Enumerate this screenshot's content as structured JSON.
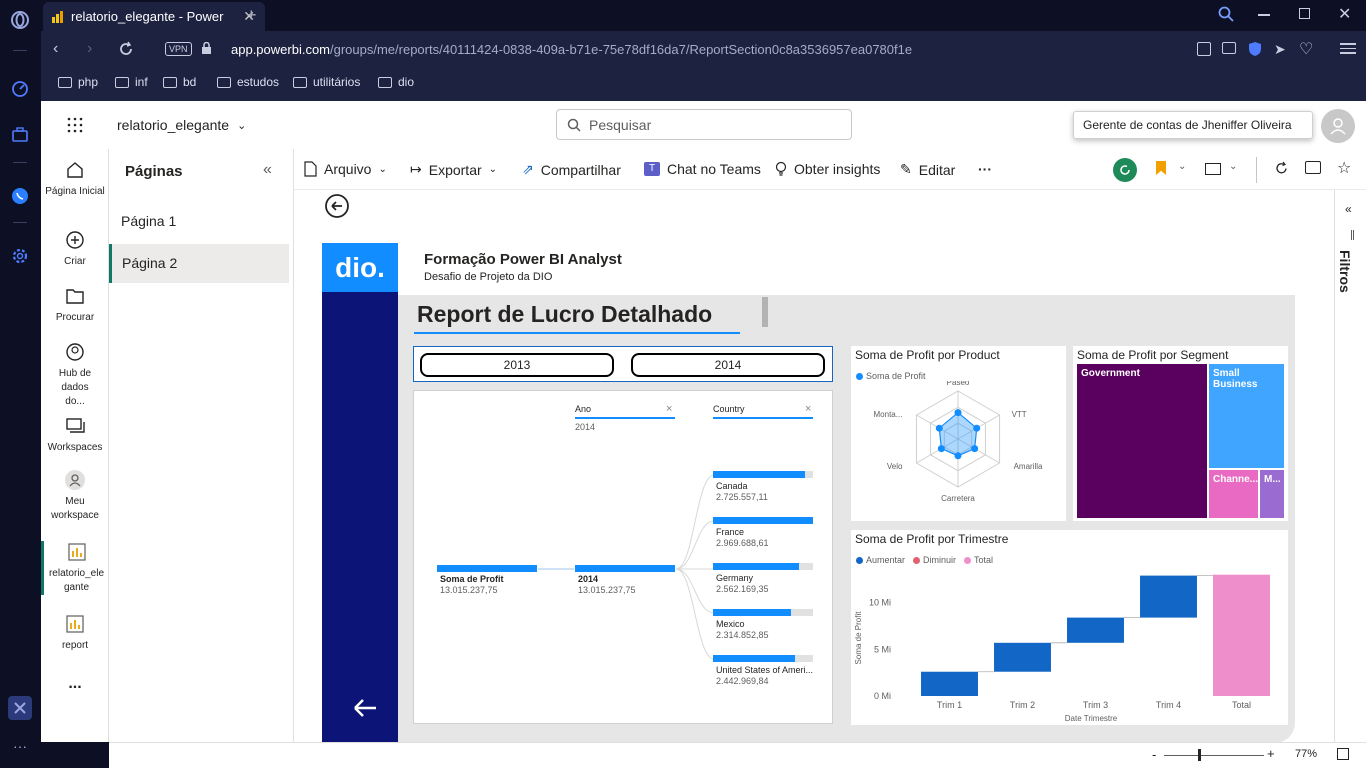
{
  "browser": {
    "tab_title": "relatorio_elegante - Power",
    "vpn_label": "VPN",
    "url_domain": "app.powerbi.com",
    "url_path": "/groups/me/reports/40111424-0838-409a-b71e-75e78df16da7/ReportSection0c8a3536957ea0780f1e",
    "bookmarks": [
      "php",
      "inf",
      "bd",
      "estudos",
      "utilitários",
      "dio"
    ]
  },
  "header": {
    "report_name": "relatorio_elegante",
    "search_placeholder": "Pesquisar",
    "account_tooltip": "Gerente de contas de Jheniffer Oliveira"
  },
  "leftnav": {
    "items": [
      {
        "label": "Página Inicial",
        "icon": "home-icon"
      },
      {
        "label": "Criar",
        "icon": "plus-icon"
      },
      {
        "label": "Procurar",
        "icon": "folder-icon"
      },
      {
        "label": "Hub de dados do...",
        "icon": "data-hub-icon"
      },
      {
        "label": "Workspaces",
        "icon": "workspaces-icon"
      },
      {
        "label": "Meu workspace",
        "icon": "person-icon"
      },
      {
        "label": "relatorio_elegante",
        "icon": "report-icon"
      },
      {
        "label": "report",
        "icon": "report-icon"
      }
    ],
    "more": "..."
  },
  "pages_panel": {
    "title": "Páginas",
    "pages": [
      "Página 1",
      "Página 2"
    ],
    "active": 1
  },
  "toolbar": {
    "arquivo": "Arquivo",
    "exportar": "Exportar",
    "compartilhar": "Compartilhar",
    "chat_teams": "Chat no Teams",
    "obter_insights": "Obter insights",
    "editar": "Editar",
    "more": "···"
  },
  "filters_label": "Filtros",
  "status": {
    "zoom_minus": "-",
    "zoom_plus": "+",
    "zoom_value": "77%"
  },
  "report": {
    "brand_logo": "dio.",
    "header_title": "Formação Power BI Analyst",
    "header_subtitle": "Desafio de Projeto da DIO",
    "main_title": "Report de Lucro Detalhado",
    "year_buttons": [
      "2013",
      "2014"
    ],
    "decomp": {
      "ano_label": "Ano",
      "ano_value": "2014",
      "country_label": "Country",
      "close_glyph": "×",
      "root": {
        "label": "Soma de Profit",
        "value": "13.015.237,75"
      },
      "year_node": {
        "label": "2014",
        "value": "13.015.237,75"
      },
      "countries": [
        {
          "name": "Canada",
          "value": "2.725.557,11",
          "fill": 0.92
        },
        {
          "name": "France",
          "value": "2.969.688,61",
          "fill": 1.0
        },
        {
          "name": "Germany",
          "value": "2.562.169,35",
          "fill": 0.86
        },
        {
          "name": "Mexico",
          "value": "2.314.852,85",
          "fill": 0.78
        },
        {
          "name": "United States of Ameri...",
          "value": "2.442.969,84",
          "fill": 0.82
        }
      ]
    },
    "radar": {
      "title": "Soma de Profit por Product",
      "legend": "Soma de Profit",
      "labels": [
        "Paseo",
        "VTT",
        "Amarilla",
        "Carretera",
        "Velo",
        "Monta..."
      ]
    },
    "treemap": {
      "title": "Soma de Profit por Segment",
      "tiles": [
        "Government",
        "Small Business",
        "Channe...",
        "M..."
      ]
    },
    "waterfall": {
      "title": "Soma de Profit por Trimestre",
      "legend": [
        "Aumentar",
        "Diminuir",
        "Total"
      ],
      "ylabel": "Soma de Profit",
      "xlabel": "Date Trimestre",
      "yticks": [
        "0 Mi",
        "5 Mi",
        "10 Mi"
      ]
    }
  },
  "colors": {
    "accent": "#118DFF",
    "dark_blue": "#0c1478",
    "purple": "#5a005e",
    "light_blue": "#3fa5ff",
    "pink": "#e96ac2",
    "lavender": "#9a6bd0",
    "waterfall_blue": "#1266c5",
    "waterfall_total": "#ee8fcb"
  },
  "chart_data": {
    "type": "bar",
    "title": "Soma de Profit por Trimestre",
    "xlabel": "Date Trimestre",
    "ylabel": "Soma de Profit",
    "categories": [
      "Trim 1",
      "Trim 2",
      "Trim 3",
      "Trim 4",
      "Total"
    ],
    "series": [
      {
        "name": "Aumentar",
        "values": [
          2.6,
          3.1,
          2.7,
          4.5,
          13.0
        ]
      }
    ],
    "ylim": [
      0,
      13.5
    ],
    "waterfall": true
  }
}
